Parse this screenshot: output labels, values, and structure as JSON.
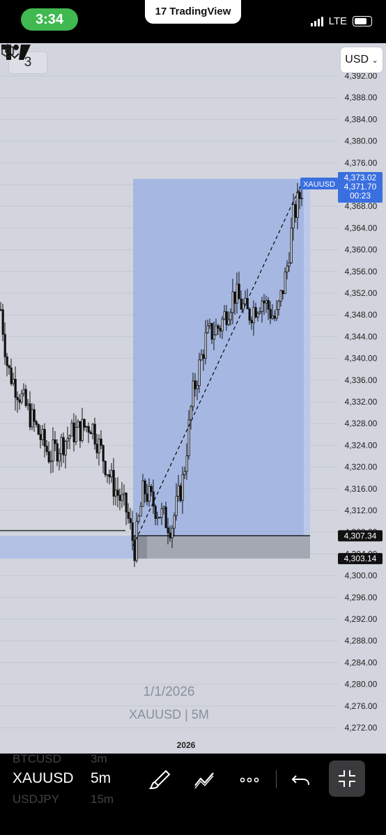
{
  "status_bar": {
    "time": "3:34",
    "app_name": "TradingView",
    "network": "LTE"
  },
  "chart": {
    "collapse_button": {
      "count": "3"
    },
    "currency_button": "USD",
    "price_scale": [
      "4,392.00",
      "4,388.00",
      "4,384.00",
      "4,380.00",
      "4,376.00",
      "4,372.00",
      "4,368.00",
      "4,364.00",
      "4,360.00",
      "4,356.00",
      "4,352.00",
      "4,348.00",
      "4,344.00",
      "4,340.00",
      "4,336.00",
      "4,332.00",
      "4,328.00",
      "4,324.00",
      "4,320.00",
      "4,316.00",
      "4,312.00",
      "4,308.00",
      "4,304.00",
      "4,300.00",
      "4,296.00",
      "4,292.00",
      "4,288.00",
      "4,284.00",
      "4,280.00",
      "4,276.00",
      "4,272.00"
    ],
    "price_labels": {
      "high": "4,373.02",
      "symbol": "XAUUSD",
      "last": "4,371.70",
      "countdown": "00:23",
      "level_1": "4,307.34",
      "level_2": "4,303.14"
    },
    "watermark_date": "1/1/2026",
    "watermark_symbol": "XAUUSD | 5M",
    "time_axis_label": "2026",
    "colors": {
      "background": "#d2d5dd",
      "range_box": "#a1b3e0",
      "last_price": "#3a6fe0"
    }
  },
  "toolbar": {
    "symbols": [
      "BTCUSD",
      "XAUUSD",
      "USDJPY"
    ],
    "timeframes": [
      "3m",
      "5m",
      "15m"
    ],
    "active_symbol": "XAUUSD",
    "active_timeframe": "5m",
    "icons": [
      "draw-brush-icon",
      "trend-line-icon",
      "more-icon",
      "undo-icon",
      "exit-fullscreen-icon"
    ]
  }
}
